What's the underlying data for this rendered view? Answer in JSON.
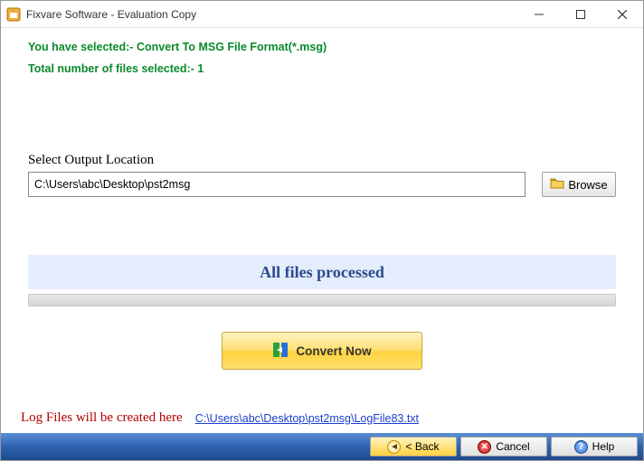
{
  "window": {
    "title": "Fixvare Software - Evaluation Copy"
  },
  "info": {
    "line1": "You have selected:- Convert To MSG File Format(*.msg)",
    "line2": "Total number of files selected:- 1"
  },
  "output": {
    "label": "Select Output Location",
    "path": "C:\\Users\\abc\\Desktop\\pst2msg",
    "browse_label": "Browse"
  },
  "status": {
    "text": "All files processed"
  },
  "convert": {
    "label": "Convert Now"
  },
  "log": {
    "label": "Log Files will be created here",
    "link": "C:\\Users\\abc\\Desktop\\pst2msg\\LogFile83.txt"
  },
  "nav": {
    "back": "< Back",
    "cancel": "Cancel",
    "help": "Help"
  }
}
